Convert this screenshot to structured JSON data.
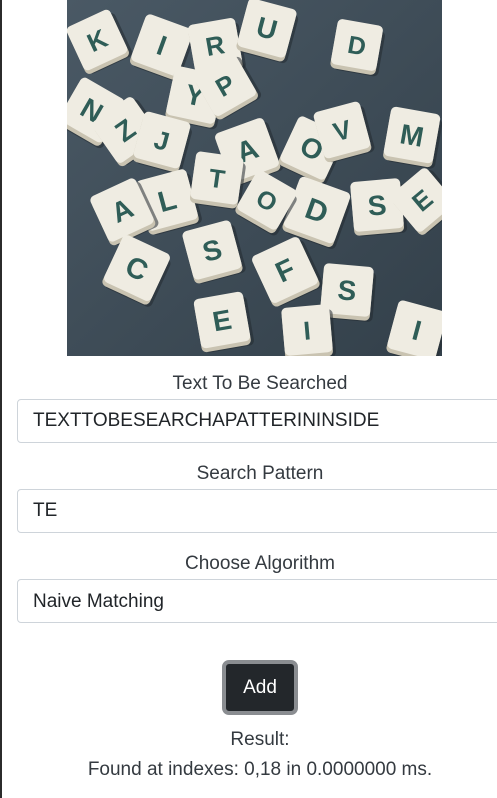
{
  "hero": {
    "image_name": "scrabble-tiles-photo",
    "tiles": [
      "K",
      "I",
      "R",
      "U",
      "Y",
      "P",
      "D",
      "N",
      "Z",
      "J",
      "A",
      "O",
      "V",
      "M",
      "S",
      "L",
      "T",
      "D",
      "A",
      "C",
      "S",
      "F",
      "S",
      "E",
      "I",
      "I",
      "E",
      "O"
    ]
  },
  "form": {
    "text_label": "Text To Be Searched",
    "text_value": "TEXTTOBESEARCHAPATTERININSIDE",
    "pattern_label": "Search Pattern",
    "pattern_value": "TE",
    "algorithm_label": "Choose Algorithm",
    "algorithm_selected": "Naive Matching"
  },
  "actions": {
    "add_label": "Add"
  },
  "result": {
    "label": "Result:",
    "text": "Found at indexes: 0,18 in 0.0000000 ms."
  },
  "colors": {
    "button_bg": "#23272b",
    "button_border": "#8a8d91",
    "tile": "#efece2",
    "tile_letter": "#2f5d57",
    "table": "#3f4d58"
  }
}
